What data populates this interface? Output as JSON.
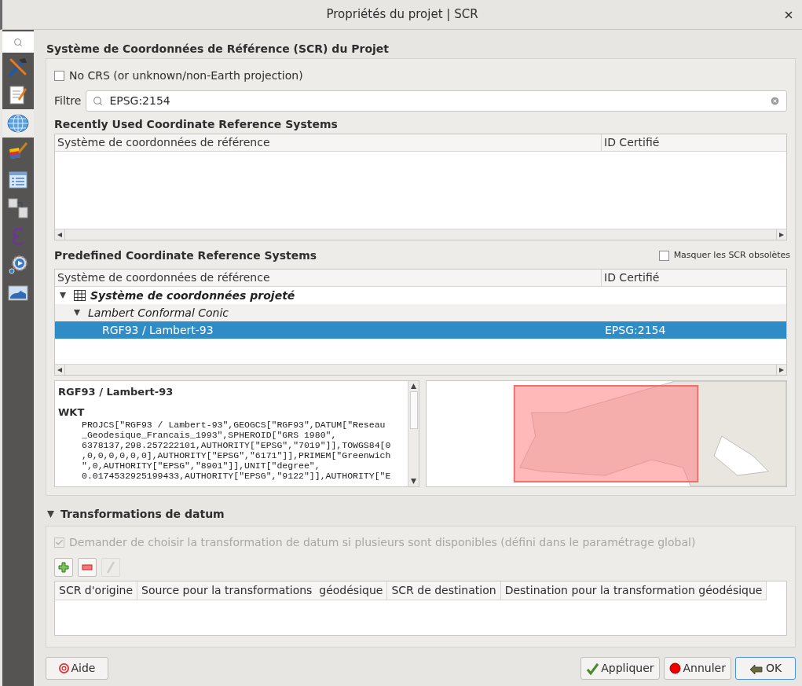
{
  "window": {
    "title": "Propriétés du projet | SCR"
  },
  "sidebar": {
    "items": [
      {
        "kind": "tools",
        "selected": false
      },
      {
        "kind": "metadata",
        "selected": false
      },
      {
        "kind": "crs",
        "selected": true
      },
      {
        "kind": "styles",
        "selected": false
      },
      {
        "kind": "sources",
        "selected": false
      },
      {
        "kind": "relations",
        "selected": false
      },
      {
        "kind": "variables",
        "selected": false
      },
      {
        "kind": "macros",
        "selected": false
      },
      {
        "kind": "services",
        "selected": false
      }
    ]
  },
  "heading": "Système de Coordonnées de Référence (SCR) du Projet",
  "no_crs": {
    "label": "No CRS (or unknown/non-Earth projection)",
    "checked": false
  },
  "filter": {
    "label": "Filtre",
    "value": "EPSG:2154"
  },
  "recent": {
    "title": "Recently Used Coordinate Reference Systems",
    "columns": [
      "Système de coordonnées de référence",
      "ID Certifié"
    ]
  },
  "predefined": {
    "title": "Predefined Coordinate Reference Systems",
    "hide_deprecated": {
      "label": "Masquer les SCR obsolètes",
      "checked": false
    },
    "columns": [
      "Système de coordonnées de référence",
      "ID Certifié"
    ],
    "tree": [
      {
        "name": "Système de coordonnées projeté",
        "expanded": true,
        "selected": false,
        "children": [
          {
            "name": "Lambert Conformal Conic",
            "expanded": true,
            "selected": false,
            "children": [
              {
                "name": "RGF93 / Lambert-93",
                "id": "EPSG:2154",
                "selected": true
              }
            ]
          }
        ]
      }
    ]
  },
  "details": {
    "title": "RGF93 / Lambert-93",
    "section": "WKT",
    "wkt": "PROJCS[\"RGF93 / Lambert-93\",GEOGCS[\"RGF93\",DATUM[\"Reseau\n_Geodesique_Francais_1993\",SPHEROID[\"GRS 1980\",\n6378137,298.257222101,AUTHORITY[\"EPSG\",\"7019\"]],TOWGS84[0\n,0,0,0,0,0,0],AUTHORITY[\"EPSG\",\"6171\"]],PRIMEM[\"Greenwich\n\",0,AUTHORITY[\"EPSG\",\"8901\"]],UNIT[\"degree\",\n0.0174532925199433,AUTHORITY[\"EPSG\",\"9122\"]],AUTHORITY[\"E"
  },
  "datum": {
    "title": "Transformations de datum",
    "expanded": true,
    "ask": {
      "label": "Demander de choisir la transformation de datum si plusieurs sont disponibles (défini dans le paramétrage global)",
      "checked": true,
      "disabled": true
    },
    "tools": [
      {
        "kind": "add",
        "disabled": false
      },
      {
        "kind": "remove",
        "disabled": false
      },
      {
        "kind": "edit",
        "disabled": true
      }
    ],
    "columns": [
      "SCR d'origine",
      "Source pour la transformations  géodésique",
      "SCR de destination",
      "Destination pour la transformation géodésique"
    ]
  },
  "buttons": [
    {
      "kind": "help",
      "label": "Aide"
    },
    {
      "kind": "apply",
      "label": "Appliquer"
    },
    {
      "kind": "cancel",
      "label": "Annuler"
    },
    {
      "kind": "ok",
      "label": "OK"
    }
  ]
}
